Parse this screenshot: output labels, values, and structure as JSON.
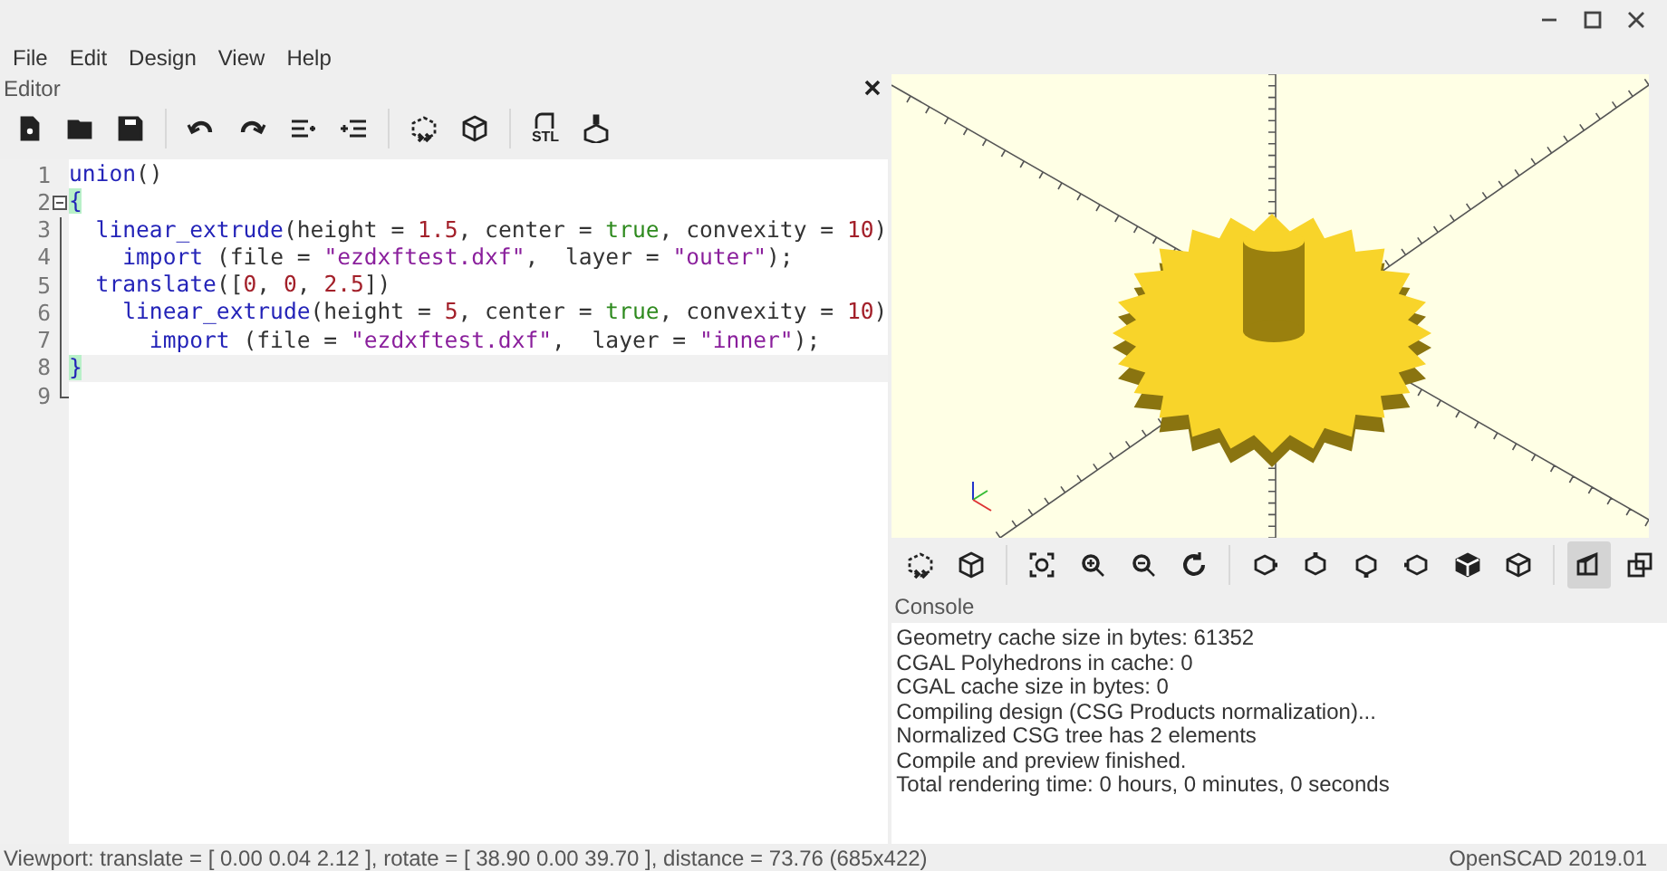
{
  "menu": [
    "File",
    "Edit",
    "Design",
    "View",
    "Help"
  ],
  "editor": {
    "title": "Editor",
    "stl_label": "STL",
    "lines": [
      {
        "number": "1",
        "current": false,
        "tokens": [
          {
            "kind": "keyword",
            "text": "union"
          },
          {
            "kind": "plain",
            "text": "()"
          }
        ]
      },
      {
        "number": "2",
        "current": false,
        "tokens": [
          {
            "kind": "brace",
            "text": "{"
          }
        ]
      },
      {
        "number": "3",
        "current": false,
        "tokens": [
          {
            "kind": "keyword",
            "text": "  linear_extrude"
          },
          {
            "kind": "plain",
            "text": "(height = "
          },
          {
            "kind": "number",
            "text": "1.5"
          },
          {
            "kind": "plain",
            "text": ", center = "
          },
          {
            "kind": "bool",
            "text": "true"
          },
          {
            "kind": "plain",
            "text": ", convexity = "
          },
          {
            "kind": "number",
            "text": "10"
          },
          {
            "kind": "plain",
            "text": ")"
          }
        ]
      },
      {
        "number": "4",
        "current": false,
        "tokens": [
          {
            "kind": "keyword",
            "text": "    import"
          },
          {
            "kind": "plain",
            "text": " (file = "
          },
          {
            "kind": "string",
            "text": "\"ezdxftest.dxf\""
          },
          {
            "kind": "plain",
            "text": ",  layer = "
          },
          {
            "kind": "string",
            "text": "\"outer\""
          },
          {
            "kind": "plain",
            "text": ");"
          }
        ]
      },
      {
        "number": "5",
        "current": false,
        "tokens": [
          {
            "kind": "keyword",
            "text": "  translate"
          },
          {
            "kind": "plain",
            "text": "(["
          },
          {
            "kind": "number",
            "text": "0"
          },
          {
            "kind": "plain",
            "text": ", "
          },
          {
            "kind": "number",
            "text": "0"
          },
          {
            "kind": "plain",
            "text": ", "
          },
          {
            "kind": "number",
            "text": "2.5"
          },
          {
            "kind": "plain",
            "text": "])"
          }
        ]
      },
      {
        "number": "6",
        "current": false,
        "tokens": [
          {
            "kind": "keyword",
            "text": "    linear_extrude"
          },
          {
            "kind": "plain",
            "text": "(height = "
          },
          {
            "kind": "number",
            "text": "5"
          },
          {
            "kind": "plain",
            "text": ", center = "
          },
          {
            "kind": "bool",
            "text": "true"
          },
          {
            "kind": "plain",
            "text": ", convexity = "
          },
          {
            "kind": "number",
            "text": "10"
          },
          {
            "kind": "plain",
            "text": ")"
          }
        ]
      },
      {
        "number": "7",
        "current": false,
        "tokens": [
          {
            "kind": "keyword",
            "text": "      import"
          },
          {
            "kind": "plain",
            "text": " (file = "
          },
          {
            "kind": "string",
            "text": "\"ezdxftest.dxf\""
          },
          {
            "kind": "plain",
            "text": ",  layer = "
          },
          {
            "kind": "string",
            "text": "\"inner\""
          },
          {
            "kind": "plain",
            "text": ");"
          }
        ]
      },
      {
        "number": "8",
        "current": true,
        "tokens": [
          {
            "kind": "brace",
            "text": "}"
          }
        ]
      },
      {
        "number": "9",
        "current": false
      }
    ]
  },
  "view_toolbar": [
    {
      "selected": false
    },
    {
      "selected": false
    },
    {
      "selected": false
    },
    {
      "selected": false
    },
    {
      "selected": false
    },
    {
      "selected": false
    },
    {
      "selected": false
    },
    {
      "selected": false
    },
    {
      "selected": false
    },
    {
      "selected": false
    },
    {
      "selected": false
    },
    {
      "selected": false
    },
    {
      "selected": true
    },
    {
      "selected": false
    }
  ],
  "console": {
    "title": "Console",
    "lines": [
      "Geometry cache size in bytes: 61352",
      "CGAL Polyhedrons in cache: 0",
      "CGAL cache size in bytes: 0",
      "Compiling design (CSG Products normalization)...",
      "Normalized CSG tree has 2 elements",
      "Compile and preview finished.",
      "Total rendering time: 0 hours, 0 minutes, 0 seconds"
    ]
  },
  "status_bar": {
    "viewport": "Viewport: translate = [ 0.00 0.04 2.12 ], rotate = [ 38.90 0.00 39.70 ], distance = 73.76 (685x422)",
    "version": "OpenSCAD 2019.01"
  }
}
